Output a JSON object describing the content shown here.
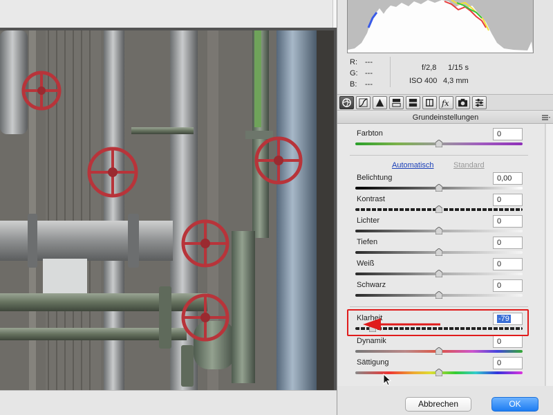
{
  "preview": {
    "image_alt": "industrial pipes with red valve wheels"
  },
  "histogram": {
    "readouts": [
      {
        "label": "R:",
        "value": "---"
      },
      {
        "label": "G:",
        "value": "---"
      },
      {
        "label": "B:",
        "value": "---"
      }
    ],
    "aperture": "f/2,8",
    "shutter": "1/15 s",
    "iso": "ISO 400",
    "focal_length": "4,3 mm"
  },
  "tabs": [
    {
      "name": "basic-tab-icon",
      "active": true
    },
    {
      "name": "tone-curve-tab-icon",
      "active": false
    },
    {
      "name": "detail-tab-icon",
      "active": false
    },
    {
      "name": "hsl-tab-icon",
      "active": false
    },
    {
      "name": "split-toning-tab-icon",
      "active": false
    },
    {
      "name": "lens-corrections-tab-icon",
      "active": false
    },
    {
      "name": "effects-tab-icon",
      "active": false
    },
    {
      "name": "camera-calibration-tab-icon",
      "active": false
    },
    {
      "name": "presets-tab-icon",
      "active": false
    }
  ],
  "section": {
    "title": "Grundeinstellungen"
  },
  "tone": {
    "auto_label": "Automatisch",
    "default_label": "Standard"
  },
  "controls": {
    "farbton": {
      "label": "Farbton",
      "value": "0",
      "level": 0.5
    },
    "belichtung": {
      "label": "Belichtung",
      "value": "0,00",
      "level": 0.5
    },
    "kontrast": {
      "label": "Kontrast",
      "value": "0",
      "level": 0.5
    },
    "lichter": {
      "label": "Lichter",
      "value": "0",
      "level": 0.5
    },
    "tiefen": {
      "label": "Tiefen",
      "value": "0",
      "level": 0.5
    },
    "weiss": {
      "label": "Weiß",
      "value": "0",
      "level": 0.5
    },
    "schwarz": {
      "label": "Schwarz",
      "value": "0",
      "level": 0.5
    },
    "klarheit": {
      "label": "Klarheit",
      "value": "-79",
      "level": 0.105
    },
    "dynamik": {
      "label": "Dynamik",
      "value": "0",
      "level": 0.5
    },
    "saettigung": {
      "label": "Sättigung",
      "value": "0",
      "level": 0.5
    }
  },
  "buttons": {
    "cancel": "Abbrechen",
    "ok": "OK"
  },
  "colors": {
    "accent": "#1d7cf2",
    "highlight": "#e01b1b",
    "valve_red": "#b8343a"
  }
}
